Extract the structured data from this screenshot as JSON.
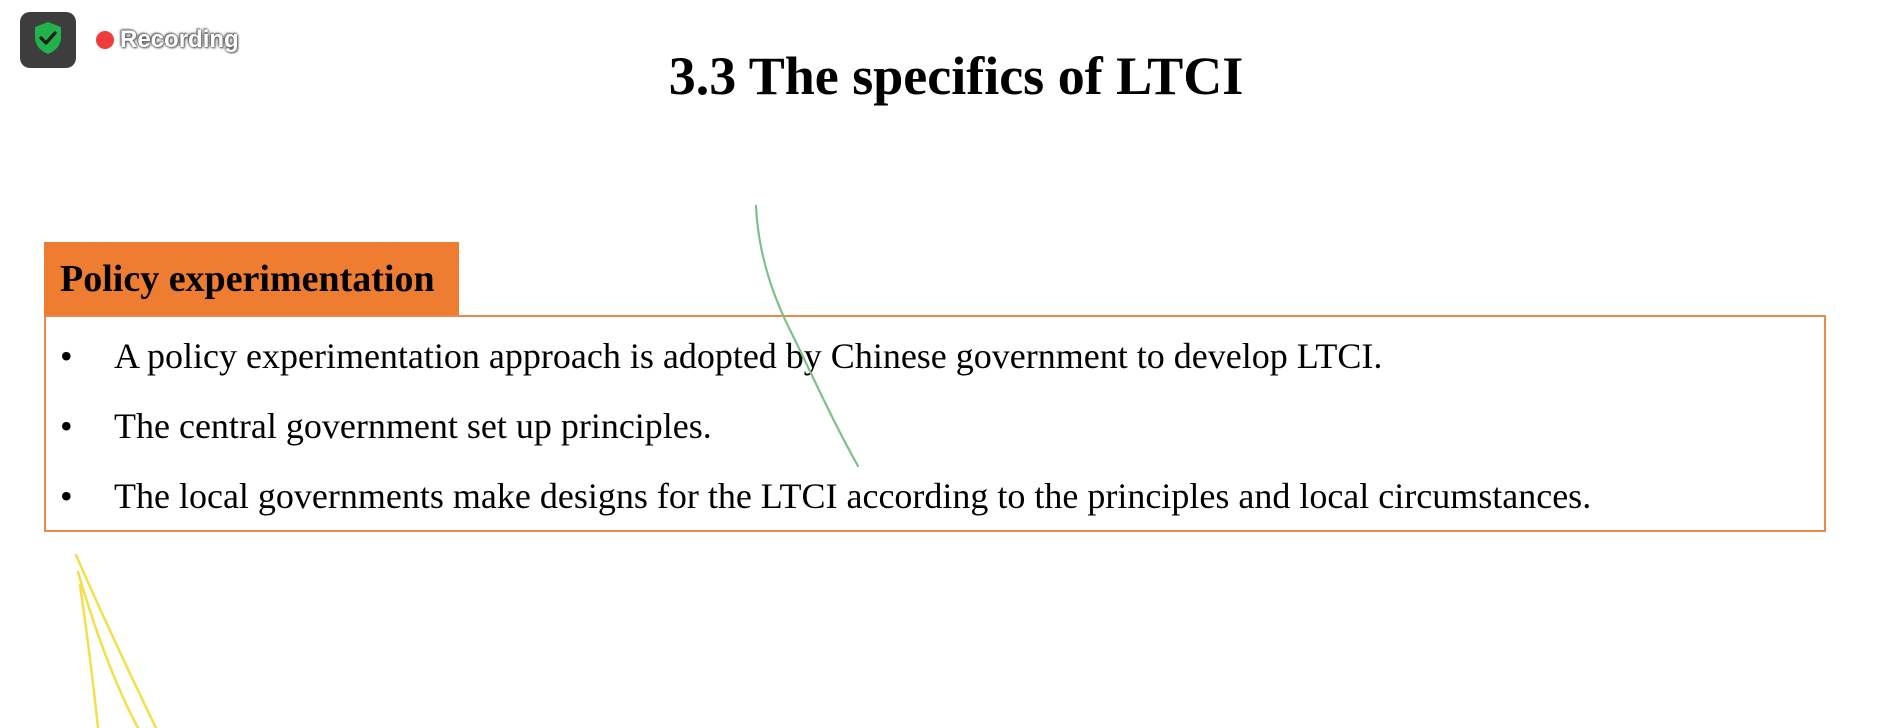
{
  "overlay": {
    "recording_label": "Recording",
    "shield_icon": "shield-check-icon",
    "colors": {
      "badge_bg": "#3d3d3d",
      "shield": "#22b14c",
      "rec_dot": "#f03c3c"
    }
  },
  "slide": {
    "title": "3.3 The specifics of LTCI",
    "section_heading": "Policy experimentation",
    "bullet_glyph": "•",
    "bullets": [
      "A policy experimentation approach is adopted by Chinese government to develop LTCI.",
      "The central government set up principles.",
      "The local governments make designs for the LTCI according to the principles and local circumstances."
    ],
    "colors": {
      "accent": "#ee7d31",
      "box_border": "#e8894f"
    }
  },
  "annotations": {
    "colors": {
      "green_stroke": "#7fbf8a",
      "yellow_stroke": "#f2e04a"
    }
  }
}
